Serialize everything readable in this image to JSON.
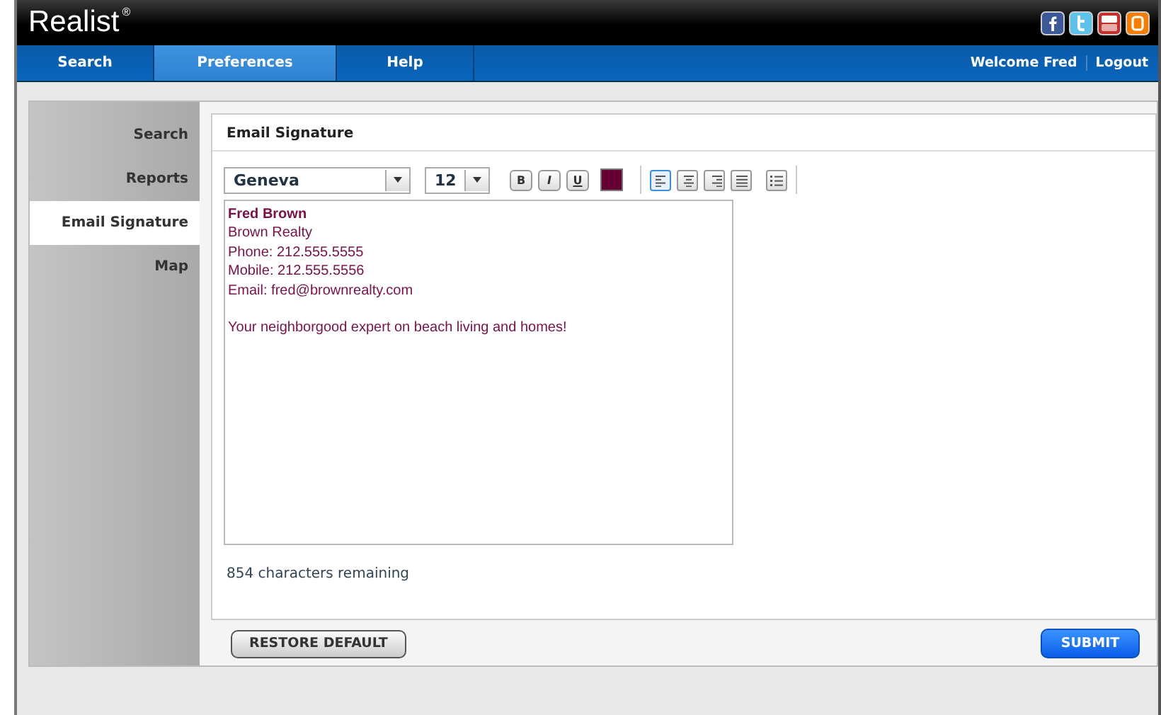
{
  "header": {
    "logo": "Realist",
    "logo_mark": "®"
  },
  "nav": {
    "tabs": [
      {
        "label": "Search",
        "selected": false
      },
      {
        "label": "Preferences",
        "selected": true
      },
      {
        "label": "Help",
        "selected": false
      }
    ],
    "welcome": "Welcome Fred",
    "logout": "Logout"
  },
  "sidebar": {
    "items": [
      {
        "label": "Search",
        "selected": false
      },
      {
        "label": "Reports",
        "selected": false
      },
      {
        "label": "Email Signature",
        "selected": true
      },
      {
        "label": "Map",
        "selected": false
      }
    ]
  },
  "section_title": "Email Signature",
  "toolbar": {
    "font": "Geneva",
    "size": "12",
    "swatch": {
      "color": "#660033"
    },
    "styles": [
      {
        "label": "B",
        "kind": "bold"
      },
      {
        "label": "I",
        "kind": "italic"
      },
      {
        "label": "U",
        "kind": "underline"
      }
    ],
    "align": [
      {
        "kind": "left",
        "selected": true
      },
      {
        "kind": "center",
        "selected": false
      },
      {
        "kind": "right",
        "selected": false
      },
      {
        "kind": "justify",
        "selected": false
      }
    ]
  },
  "signature": {
    "paragraphs": [
      [
        {
          "text": "Fred Brown",
          "bold": true
        },
        {
          "text": "Brown Realty",
          "bold": false
        },
        {
          "text": "Phone: 212.555.5555",
          "bold": false
        },
        {
          "text": "Mobile: 212.555.5556",
          "bold": false
        },
        {
          "text": "Email: fred@brownrealty.com",
          "bold": false
        }
      ],
      [
        {
          "text": "Your neighborgood expert on beach living and homes!",
          "bold": false
        }
      ]
    ]
  },
  "counter": "854 characters remaining",
  "buttons": {
    "restore": "RESTORE DEFAULT",
    "submit": "SUBMIT"
  }
}
